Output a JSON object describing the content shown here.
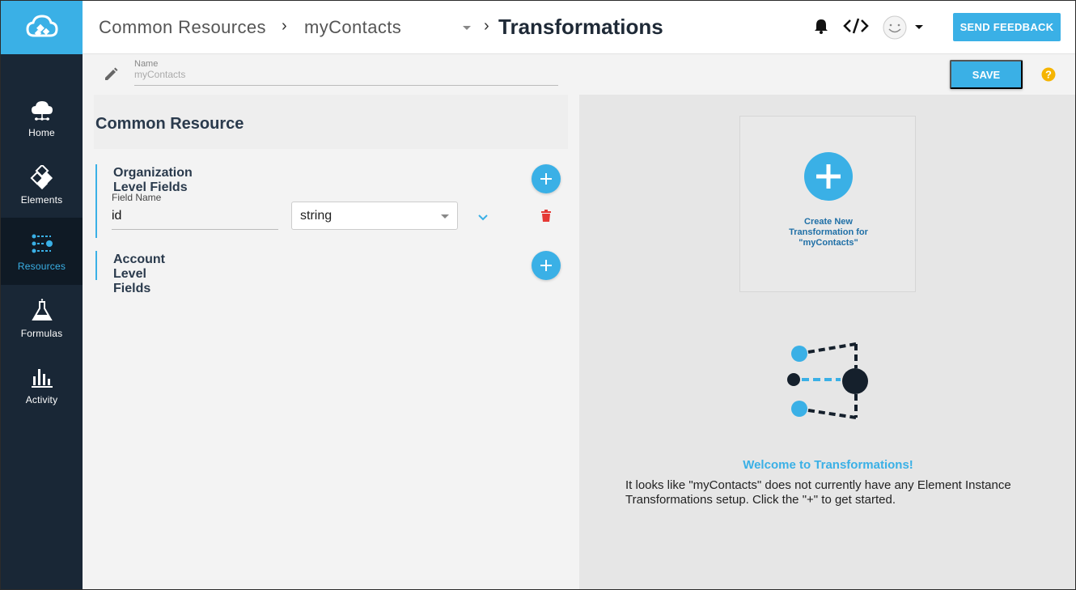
{
  "sidebar": {
    "items": [
      {
        "label": "Home",
        "icon": "cloud-network-icon"
      },
      {
        "label": "Elements",
        "icon": "elements-icon"
      },
      {
        "label": "Resources",
        "icon": "resources-icon",
        "active": true
      },
      {
        "label": "Formulas",
        "icon": "flask-icon"
      },
      {
        "label": "Activity",
        "icon": "bar-chart-icon"
      }
    ]
  },
  "header": {
    "breadcrumb_root": "Common Resources",
    "breadcrumb_resource": "myContacts",
    "title": "Transformations",
    "feedback_label": "SEND FEEDBACK"
  },
  "subheader": {
    "name_label": "Name",
    "name_value": "myContacts",
    "save_label": "SAVE"
  },
  "common_resource": {
    "title": "Common Resource",
    "org_section_title": "Organization Level Fields",
    "field_label": "Field Name",
    "field_value": "id",
    "field_type": "string",
    "account_section_title": "Account Level Fields"
  },
  "transformations": {
    "create_label": "Create New\nTransformation for\n\"myContacts\"",
    "welcome_title": "Welcome to Transformations!",
    "welcome_body": "It looks like \"myContacts\" does not currently have any Element Instance Transformations setup. Click the \"+\" to get started."
  },
  "colors": {
    "accent": "#3ab0e6",
    "sidebar": "#192736",
    "delete": "#e53935",
    "help": "#f5b400"
  }
}
